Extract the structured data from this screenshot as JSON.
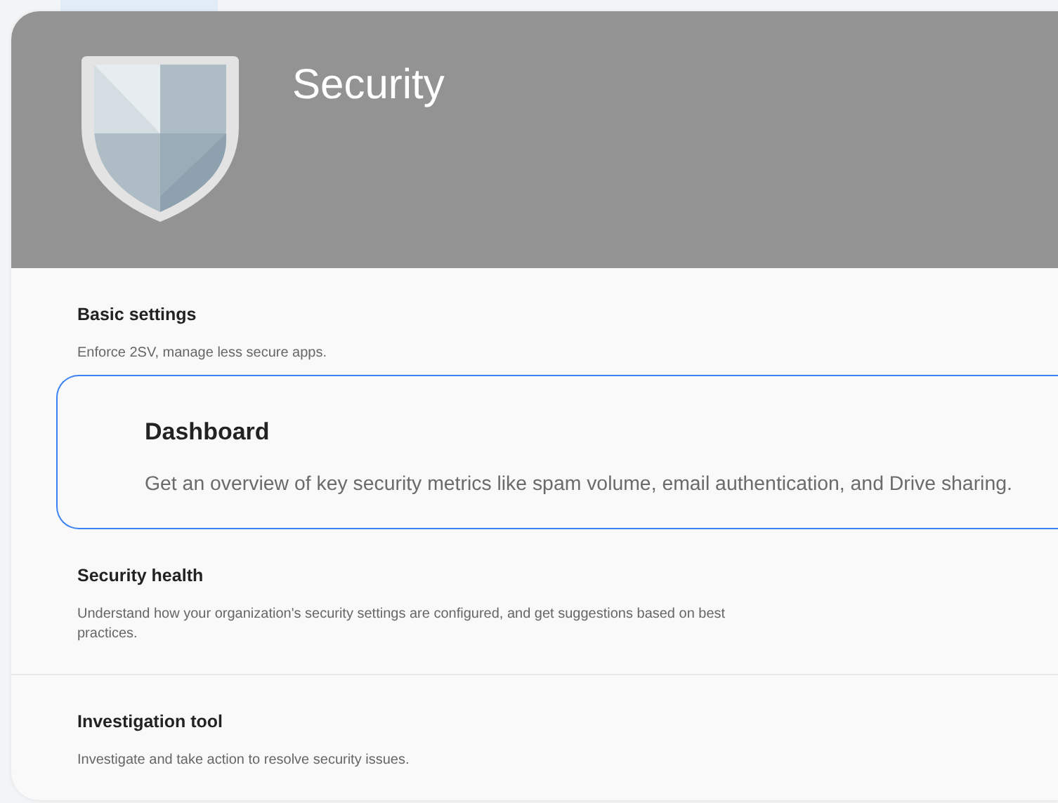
{
  "header": {
    "title": "Security"
  },
  "sections": [
    {
      "title": "Basic settings",
      "description": "Enforce 2SV, manage less secure apps.",
      "selected": false
    },
    {
      "title": "Dashboard",
      "description": "Get an overview of key security metrics like spam volume, email authentication, and Drive sharing.",
      "selected": true
    },
    {
      "title": "Security health",
      "description": "Understand how your organization's security settings are configured, and get suggestions based on best practices.",
      "selected": false
    },
    {
      "title": "Investigation tool",
      "description": "Investigate and take action to resolve security issues.",
      "selected": false
    }
  ]
}
